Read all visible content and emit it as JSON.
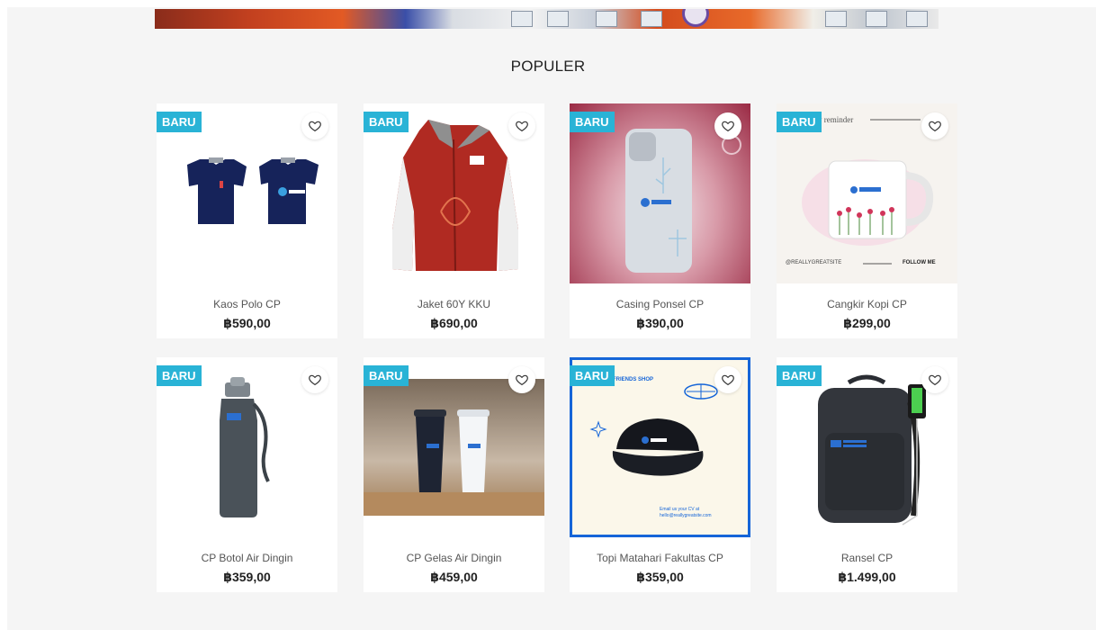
{
  "section": {
    "title": "POPULER"
  },
  "badge_color": "#29b3d6",
  "products": [
    {
      "badge": "BARU",
      "name": "Kaos Polo CP",
      "price": "฿590,00",
      "image": "polo-shirts-image"
    },
    {
      "badge": "BARU",
      "name": "Jaket 60Y KKU",
      "price": "฿690,00",
      "image": "jacket-image"
    },
    {
      "badge": "BARU",
      "name": "Casing Ponsel CP",
      "price": "฿390,00",
      "image": "phone-case-image"
    },
    {
      "badge": "BARU",
      "name": "Cangkir Kopi CP",
      "price": "฿299,00",
      "image": "coffee-mug-image",
      "image_text": {
        "top": "y reminder",
        "bottom_left": "@REALLYGREATSITE",
        "bottom_right": "FOLLOW ME"
      }
    },
    {
      "badge": "BARU",
      "name": "CP Botol Air Dingin",
      "price": "฿359,00",
      "image": "water-bottle-image"
    },
    {
      "badge": "BARU",
      "name": "CP Gelas Air Dingin",
      "price": "฿459,00",
      "image": "tumblers-image"
    },
    {
      "badge": "BARU",
      "name": "Topi Matahari Fakultas CP",
      "price": "฿359,00",
      "image": "cap-image",
      "image_text": {
        "top": "FRIENDS SHOP",
        "bottom": "Email us your CV at hello@reallygreatsite.com"
      }
    },
    {
      "badge": "BARU",
      "name": "Ransel CP",
      "price": "฿1.499,00",
      "image": "backpack-image"
    }
  ]
}
